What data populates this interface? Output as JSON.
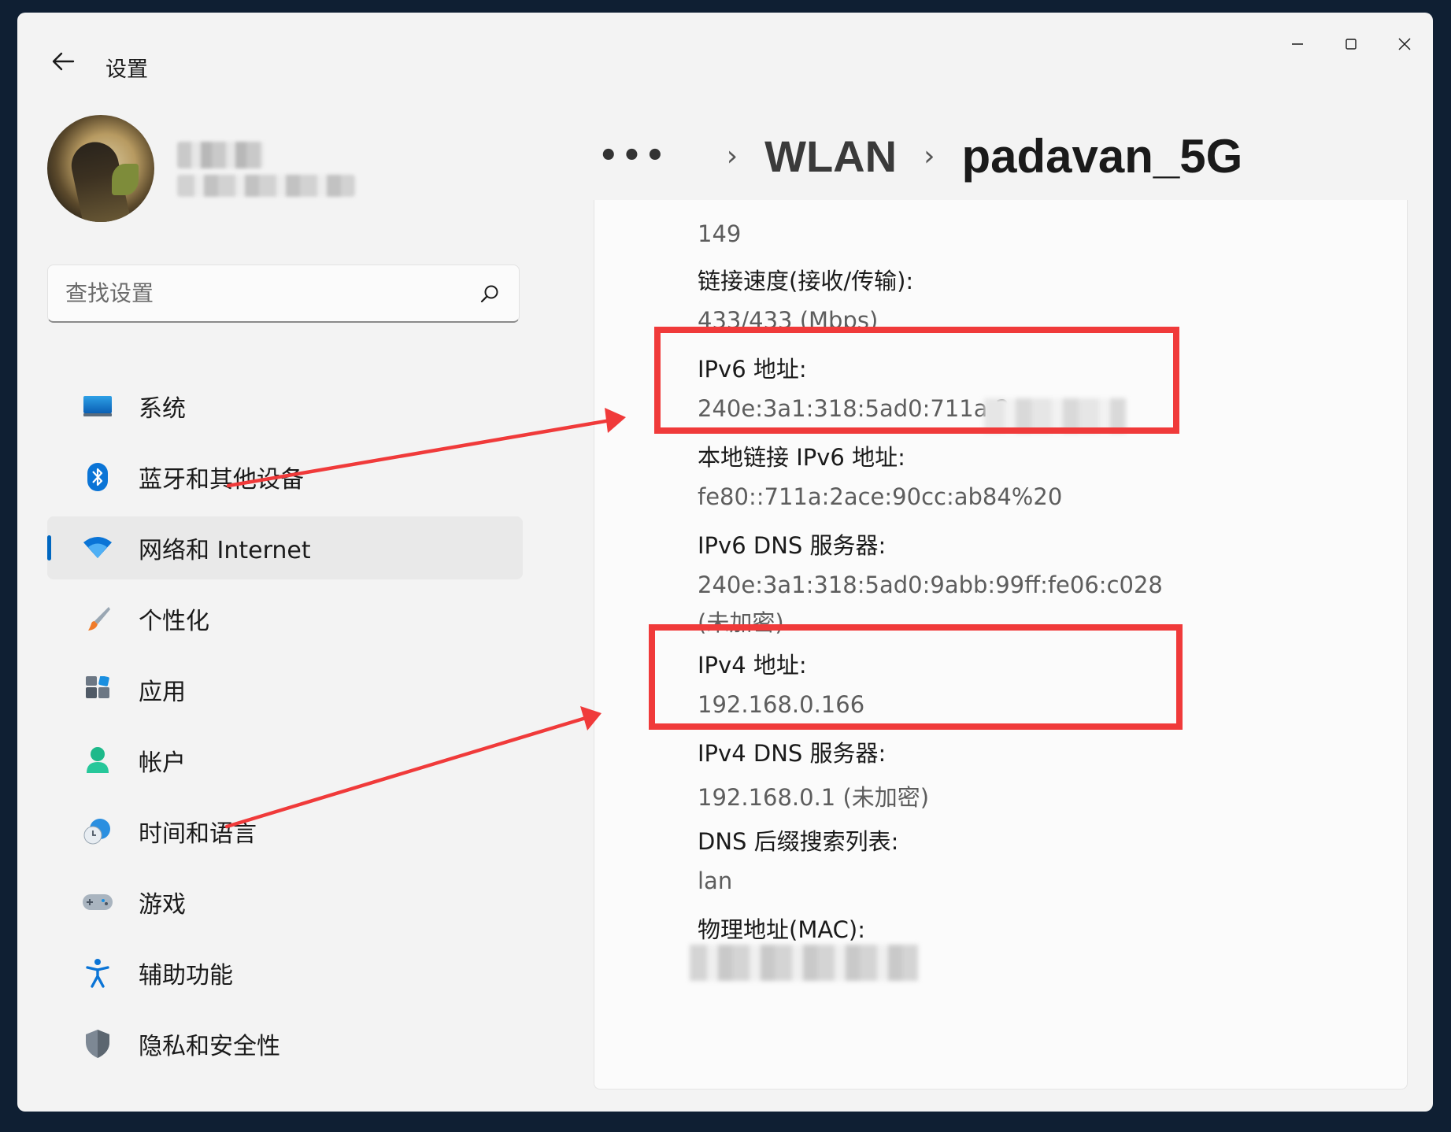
{
  "window": {
    "title": "设置",
    "controls": [
      "minimize",
      "maximize",
      "close"
    ]
  },
  "search": {
    "placeholder": "查找设置",
    "icon": "search-icon"
  },
  "nav": {
    "items": [
      {
        "label": "系统",
        "icon": "system-icon",
        "active": false
      },
      {
        "label": "蓝牙和其他设备",
        "icon": "bluetooth-icon",
        "active": false
      },
      {
        "label": "网络和 Internet",
        "icon": "wifi-icon",
        "active": true
      },
      {
        "label": "个性化",
        "icon": "brush-icon",
        "active": false
      },
      {
        "label": "应用",
        "icon": "apps-icon",
        "active": false
      },
      {
        "label": "帐户",
        "icon": "account-icon",
        "active": false
      },
      {
        "label": "时间和语言",
        "icon": "time-language-icon",
        "active": false
      },
      {
        "label": "游戏",
        "icon": "gamepad-icon",
        "active": false
      },
      {
        "label": "辅助功能",
        "icon": "accessibility-icon",
        "active": false
      },
      {
        "label": "隐私和安全性",
        "icon": "shield-icon",
        "active": false
      }
    ],
    "accent": "#0067c0"
  },
  "breadcrumb": {
    "more": "•••",
    "parent": "WLAN",
    "current": "padavan_5G"
  },
  "properties": {
    "channel_value": "149",
    "link_speed_label": "链接速度(接收/传输):",
    "link_speed_value": "433/433 (Mbps)",
    "ipv6_label": "IPv6 地址:",
    "ipv6_value": "240e:3a1:318:5ad0:711a:2a",
    "local_ipv6_label": "本地链接 IPv6 地址:",
    "local_ipv6_value": "fe80::711a:2ace:90cc:ab84%20",
    "ipv6_dns_label": "IPv6 DNS 服务器:",
    "ipv6_dns_value": "240e:3a1:318:5ad0:9abb:99ff:fe06:c028",
    "ipv6_dns_note": "(未加密)",
    "ipv4_label": "IPv4 地址:",
    "ipv4_value": "192.168.0.166",
    "ipv4_dns_label": "IPv4 DNS 服务器:",
    "ipv4_dns_value": "192.168.0.1 (未加密)",
    "dns_suffix_label": "DNS 后缀搜索列表:",
    "dns_suffix_value": "lan",
    "mac_label": "物理地址(MAC):"
  },
  "annotation_color": "#f03a3a"
}
